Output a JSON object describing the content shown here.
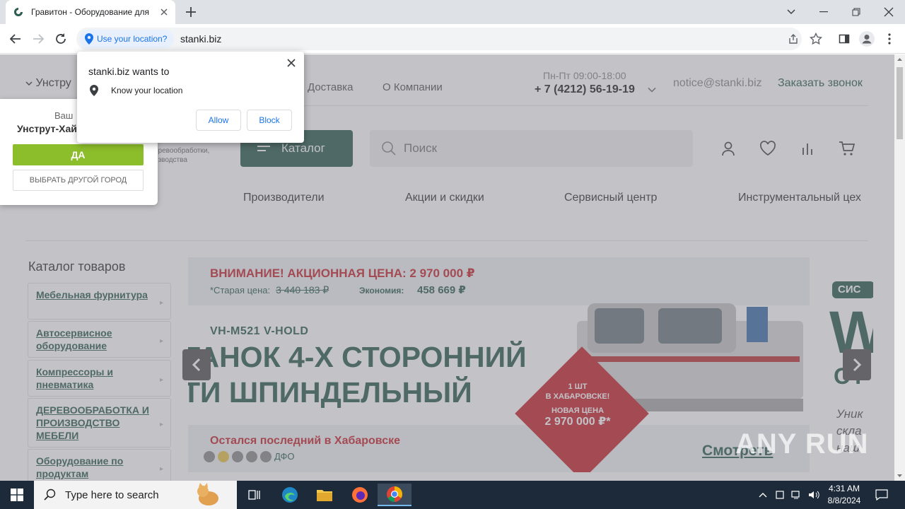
{
  "browser": {
    "tab_title": "Гравитон - Оборудование для д",
    "url": "stanki.biz",
    "location_chip": "Use your location?"
  },
  "permission": {
    "heading": "stanki.biz wants to",
    "item": "Know your location",
    "allow": "Allow",
    "block": "Block"
  },
  "city_popup": {
    "question": "Ваш",
    "city": "Унструт-Хай",
    "yes": "ДА",
    "other": "ВЫБРАТЬ ДРУГОЙ ГОРОД"
  },
  "header": {
    "city_link": "Унстру",
    "nav": [
      "Доставка",
      "О Компании"
    ],
    "hours": "Пн-Пт 09:00-18:00",
    "phone": "+ 7 (4212) 56-19-19",
    "email": "notice@stanki.biz",
    "callback": "Заказать звонок",
    "logo_sub_1": "еревообработки,",
    "logo_sub_2": "изводства",
    "catalog": "Каталог",
    "search_placeholder": "Поиск"
  },
  "subnav": [
    "Производители",
    "Акции и скидки",
    "Сервисный центр",
    "Инструментальный цех"
  ],
  "sidebar": {
    "title": "Каталог товаров",
    "items": [
      "Мебельная фурнитура",
      "Автосервисное оборудование",
      "Компрессоры и пневматика",
      "ДЕРЕВООБРАБОТКА И ПРОИЗВОДСТВО МЕБЕЛИ",
      "Оборудование по продуктам"
    ]
  },
  "banner": {
    "attention": "ВНИМАНИЕ! АКЦИОННАЯ ЦЕНА: 2 970 000 ₽",
    "old_label": "*Старая цена:",
    "old_price": "3 440 183 ₽",
    "economy_label": "Экономия:",
    "economy_value": "458 669 ₽",
    "model": "VH-M521 V-HOLD",
    "headline_1": "ТАНОК 4-Х СТОРОННИЙ",
    "headline_2": "ТИ ШПИНДЕЛЬНЫЙ",
    "badge_1": "1 ШТ",
    "badge_2": "В ХАБАРОВСКЕ!",
    "badge_3": "НОВАЯ ЦЕНА",
    "badge_price": "2 970 000 ₽*",
    "last": "Остался последний в Хабаровске",
    "dfo": "ДФО",
    "look": "Смотреть",
    "dots_count": 5,
    "active_dot": 2
  },
  "next_slide": {
    "badge": "СИС",
    "big": "W",
    "ot": "ОТ",
    "line1": "Уник",
    "line2": "скла",
    "line3": "наш"
  },
  "watermark": "ANY RUN",
  "taskbar": {
    "search_placeholder": "Type here to search",
    "time": "4:31 AM",
    "date": "8/8/2024"
  }
}
